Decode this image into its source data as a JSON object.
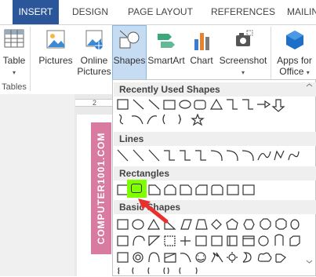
{
  "tabs": [
    {
      "label": "INSERT",
      "active": true
    },
    {
      "label": "DESIGN"
    },
    {
      "label": "PAGE LAYOUT"
    },
    {
      "label": "REFERENCES"
    },
    {
      "label": "MAILIN"
    }
  ],
  "ribbon": {
    "table": {
      "label": "Table",
      "group": "Tables"
    },
    "pictures": {
      "label": "Pictures"
    },
    "online_pictures": {
      "line1": "Online",
      "line2": "Pictures"
    },
    "shapes": {
      "label": "Shapes"
    },
    "smartart": {
      "label": "SmartArt"
    },
    "chart": {
      "label": "Chart"
    },
    "screenshot": {
      "label": "Screenshot"
    },
    "apps": {
      "line1": "Apps for",
      "line2": "Office"
    }
  },
  "ruler": {
    "mark": "2"
  },
  "watermark": {
    "text": "COMPUTER1001.COM"
  },
  "menu": {
    "sections": [
      {
        "title": "Recently Used Shapes"
      },
      {
        "title": "Lines"
      },
      {
        "title": "Rectangles"
      },
      {
        "title": "Basic Shapes"
      }
    ],
    "selected_shape": "rounded-rectangle"
  },
  "colors": {
    "tab_active": "#2b579a",
    "accent": "#2b579a",
    "highlight": "#7fff00",
    "arrow": "#e8302e",
    "watermark": "#d97aa0"
  }
}
